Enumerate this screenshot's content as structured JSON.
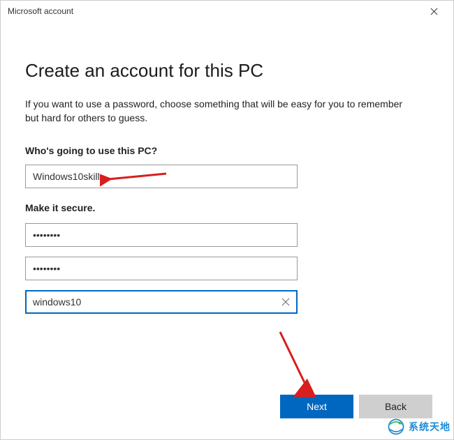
{
  "window": {
    "title": "Microsoft account"
  },
  "page": {
    "heading": "Create an account for this PC",
    "description": "If you want to use a password, choose something that will be easy for you to remember but hard for others to guess.",
    "username_label": "Who's going to use this PC?",
    "secure_label": "Make it secure."
  },
  "fields": {
    "username_value": "Windows10skill",
    "password_value": "••••••••",
    "confirm_value": "••••••••",
    "hint_value": "windows10"
  },
  "buttons": {
    "next": "Next",
    "back": "Back"
  },
  "watermark": {
    "text": "系统天地"
  }
}
